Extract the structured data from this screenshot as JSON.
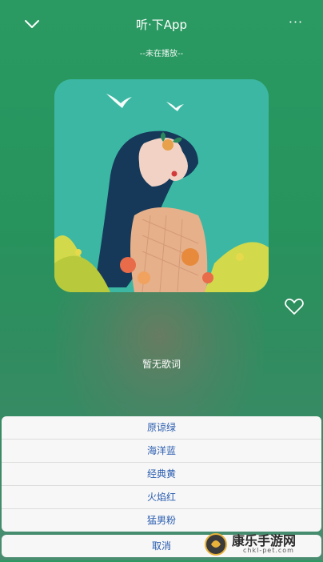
{
  "header": {
    "title": "听·下App",
    "back_icon": "chevron-down-icon",
    "more_icon": "more-dots-icon",
    "more_text": "···"
  },
  "player": {
    "status": "--未在播放--",
    "cover_icon": "album-cover-illustration",
    "favorite_icon": "heart-outline-icon",
    "lyrics_text": "暂无歌词"
  },
  "theme_sheet": {
    "options": [
      "原谅绿",
      "海洋蓝",
      "经典黄",
      "火焰红",
      "猛男粉"
    ],
    "cancel_label": "取消"
  },
  "watermark": {
    "text": "康乐手游网",
    "subtext": "chkl-pet.com"
  },
  "colors": {
    "background": "#2a9a62",
    "sheet_text": "#2a5db0",
    "sheet_bg": "#f7f7f7"
  }
}
